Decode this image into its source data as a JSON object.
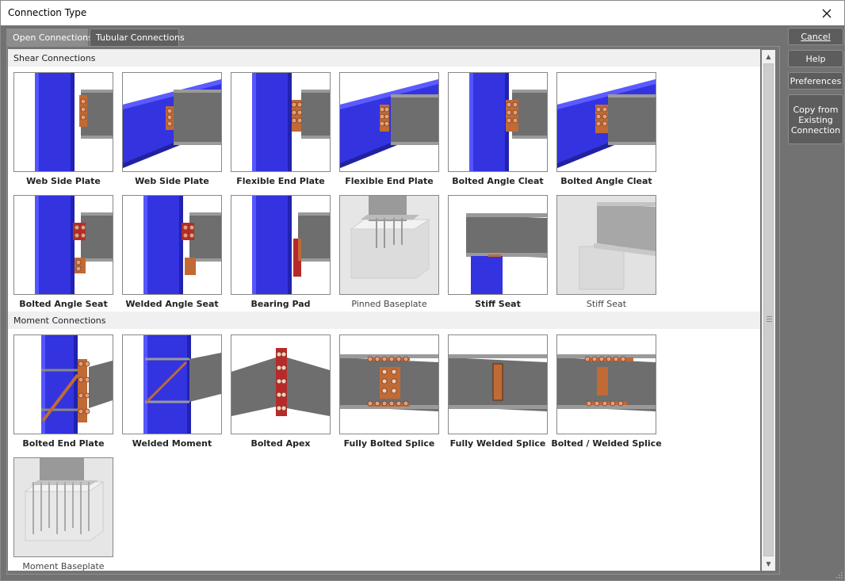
{
  "window": {
    "title": "Connection Type"
  },
  "tabs": [
    {
      "label": "Open Connections",
      "active": true
    },
    {
      "label": "Tubular Connections",
      "active": false
    }
  ],
  "sections": [
    {
      "label": "Shear Connections"
    },
    {
      "label": "Moment Connections"
    }
  ],
  "shear": [
    {
      "label": "Web Side Plate",
      "icon": "web-side-plate-column-icon",
      "enabled": true
    },
    {
      "label": "Web Side Plate",
      "icon": "web-side-plate-beam-icon",
      "enabled": true
    },
    {
      "label": "Flexible End Plate",
      "icon": "flexible-end-plate-column-icon",
      "enabled": true
    },
    {
      "label": "Flexible End Plate",
      "icon": "flexible-end-plate-beam-icon",
      "enabled": true
    },
    {
      "label": "Bolted Angle Cleat",
      "icon": "bolted-angle-cleat-column-icon",
      "enabled": true
    },
    {
      "label": "Bolted Angle Cleat",
      "icon": "bolted-angle-cleat-beam-icon",
      "enabled": true
    },
    {
      "label": "Bolted Angle Seat",
      "icon": "bolted-angle-seat-icon",
      "enabled": true
    },
    {
      "label": "Welded Angle Seat",
      "icon": "welded-angle-seat-icon",
      "enabled": true
    },
    {
      "label": "Bearing Pad",
      "icon": "bearing-pad-icon",
      "enabled": true
    },
    {
      "label": "Pinned Baseplate",
      "icon": "pinned-baseplate-icon",
      "enabled": false
    },
    {
      "label": "Stiff Seat",
      "icon": "stiff-seat-icon",
      "enabled": true
    },
    {
      "label": "Stiff Seat",
      "icon": "stiff-seat-disabled-icon",
      "enabled": false
    }
  ],
  "moment": [
    {
      "label": "Bolted End Plate",
      "icon": "bolted-end-plate-icon",
      "enabled": true
    },
    {
      "label": "Welded Moment",
      "icon": "welded-moment-icon",
      "enabled": true
    },
    {
      "label": "Bolted Apex",
      "icon": "bolted-apex-icon",
      "enabled": true
    },
    {
      "label": "Fully Bolted Splice",
      "icon": "fully-bolted-splice-icon",
      "enabled": true
    },
    {
      "label": "Fully Welded Splice",
      "icon": "fully-welded-splice-icon",
      "enabled": true
    },
    {
      "label": "Bolted / Welded Splice",
      "icon": "bolted-welded-splice-icon",
      "enabled": true
    },
    {
      "label": "Moment Baseplate",
      "icon": "moment-baseplate-icon",
      "enabled": false
    }
  ],
  "buttons": {
    "cancel": "Cancel",
    "help": "Help",
    "preferences": "Preferences",
    "copy": [
      "Copy from",
      "Existing",
      "Connection"
    ]
  },
  "colors": {
    "column_blue": "#3333e0",
    "beam_grey": "#6e6e6e",
    "plate_orange": "#c06a35",
    "plate_red": "#b82a2a"
  }
}
